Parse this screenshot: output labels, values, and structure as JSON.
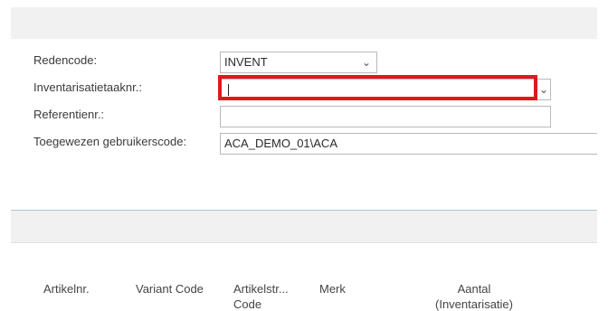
{
  "form": {
    "reason_code": {
      "label": "Redencode:",
      "value": "INVENT"
    },
    "inventory_task_no": {
      "label": "Inventarisatietaaknr.:",
      "value": ""
    },
    "reference_no": {
      "label": "Referentienr.:",
      "value": ""
    },
    "assigned_user_code": {
      "label": "Toegewezen gebruikerscode:",
      "value": "ACA_DEMO_01\\ACA"
    }
  },
  "lines": {
    "columns": [
      {
        "line1": "Artikelnr.",
        "line2": ""
      },
      {
        "line1": "Variant Code",
        "line2": ""
      },
      {
        "line1": "Artikelstr...",
        "line2": "Code"
      },
      {
        "line1": "Merk",
        "line2": ""
      },
      {
        "line1": "Aantal",
        "line2": "(Inventarisatie)"
      }
    ]
  },
  "icons": {
    "dropdown": "chevron-down-icon"
  },
  "colors": {
    "highlight": "#e0181e",
    "separator": "#a9c7e3"
  }
}
